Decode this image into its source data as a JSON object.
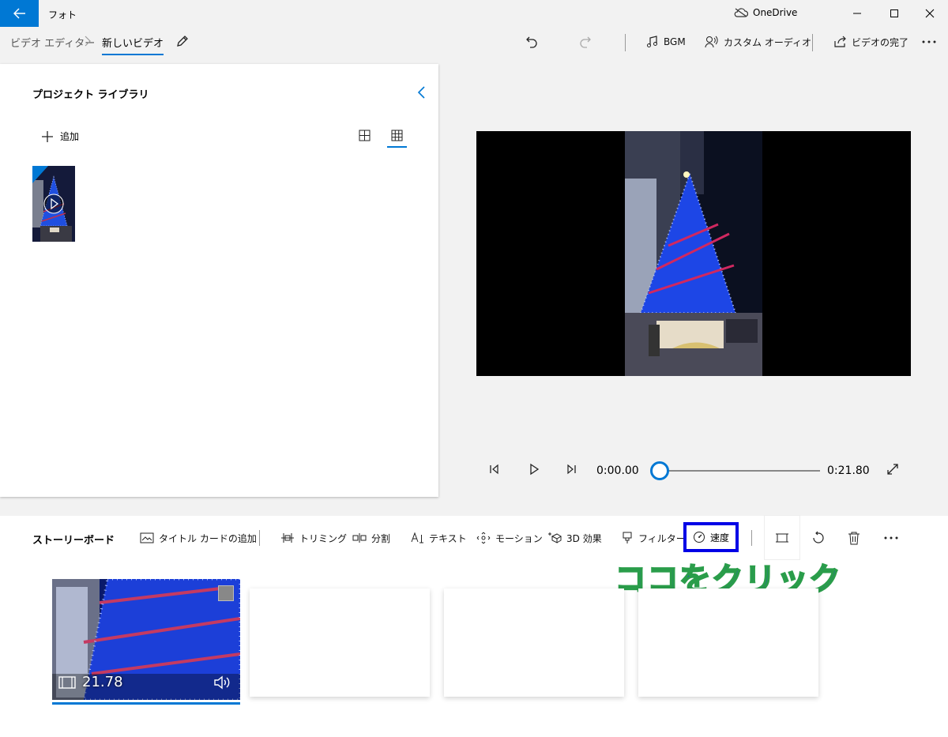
{
  "window": {
    "app_title": "フォト",
    "onedrive_label": "OneDrive"
  },
  "breadcrumb": {
    "root": "ビデオ エディター",
    "current": "新しいビデオ"
  },
  "toolbar": {
    "bgm": "BGM",
    "custom_audio": "カスタム オーディオ",
    "finish_video": "ビデオの完了"
  },
  "library": {
    "title": "プロジェクト ライブラリ",
    "add_label": "追加"
  },
  "playback": {
    "current_time": "0:00.00",
    "total_time": "0:21.80",
    "position_fraction": 0
  },
  "storyboard": {
    "title": "ストーリーボード",
    "tools": {
      "title_card": "タイトル カードの追加",
      "trim": "トリミング",
      "split": "分割",
      "text": "テキスト",
      "motion": "モーション",
      "effects_3d": "3D 効果",
      "filter": "フィルター",
      "speed": "速度"
    },
    "callout": "ココをクリック",
    "clips": [
      {
        "duration": "21.78"
      }
    ]
  },
  "colors": {
    "accent": "#0078d4",
    "highlight_box": "#0000e6",
    "callout_text": "#1a44d8",
    "callout_outline": "#2a9d4a"
  }
}
